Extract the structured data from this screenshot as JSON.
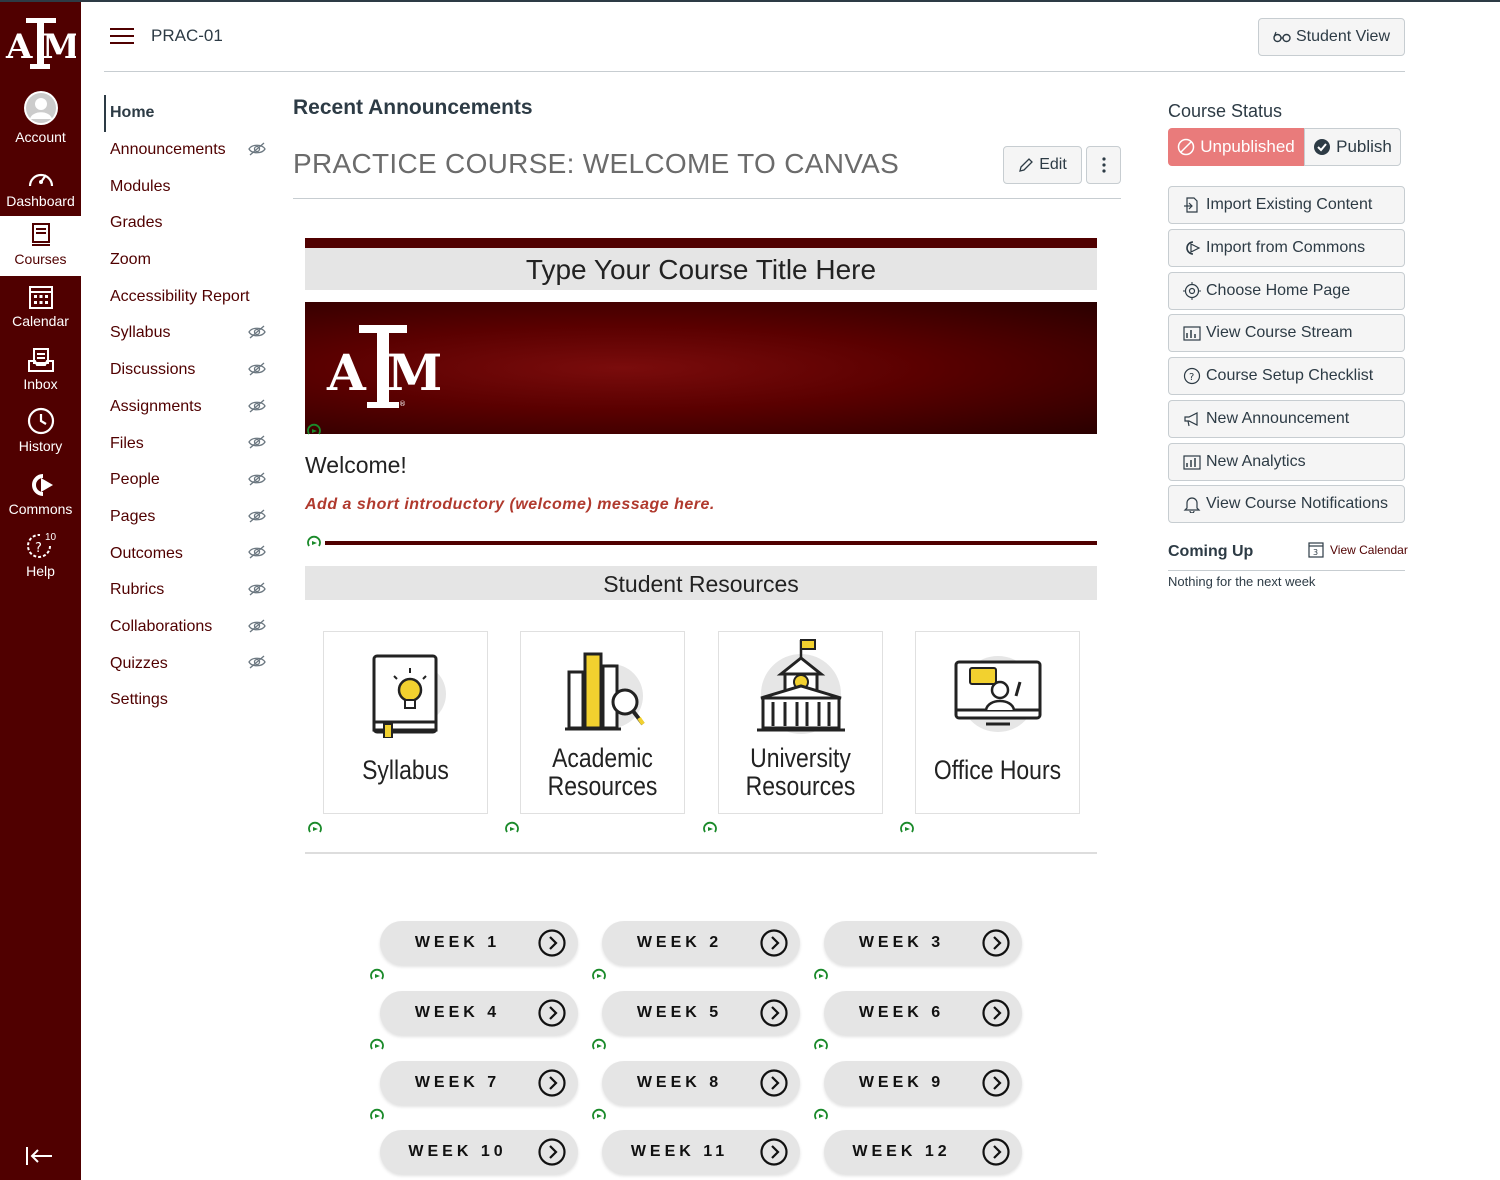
{
  "global_nav": {
    "items": [
      {
        "label": "Account",
        "icon": "account-icon"
      },
      {
        "label": "Dashboard",
        "icon": "dashboard-icon"
      },
      {
        "label": "Courses",
        "icon": "courses-icon",
        "active": true
      },
      {
        "label": "Calendar",
        "icon": "calendar-icon"
      },
      {
        "label": "Inbox",
        "icon": "inbox-icon"
      },
      {
        "label": "History",
        "icon": "history-icon"
      },
      {
        "label": "Commons",
        "icon": "commons-icon"
      },
      {
        "label": "Help",
        "icon": "help-icon",
        "badge": "10"
      }
    ],
    "brand_color": "#500000"
  },
  "header": {
    "breadcrumb": "PRAC-01",
    "student_view_label": "Student View"
  },
  "course_nav": {
    "items": [
      {
        "label": "Home",
        "active": true,
        "hidden": false
      },
      {
        "label": "Announcements",
        "hidden": true
      },
      {
        "label": "Modules",
        "hidden": false
      },
      {
        "label": "Grades",
        "hidden": false
      },
      {
        "label": "Zoom",
        "hidden": false
      },
      {
        "label": "Accessibility Report",
        "hidden": false
      },
      {
        "label": "Syllabus",
        "hidden": true
      },
      {
        "label": "Discussions",
        "hidden": true
      },
      {
        "label": "Assignments",
        "hidden": true
      },
      {
        "label": "Files",
        "hidden": true
      },
      {
        "label": "People",
        "hidden": true
      },
      {
        "label": "Pages",
        "hidden": true
      },
      {
        "label": "Outcomes",
        "hidden": true
      },
      {
        "label": "Rubrics",
        "hidden": true
      },
      {
        "label": "Collaborations",
        "hidden": true
      },
      {
        "label": "Quizzes",
        "hidden": true
      },
      {
        "label": "Settings",
        "hidden": false
      }
    ]
  },
  "main": {
    "recent_announcements": "Recent Announcements",
    "page_title": "PRACTICE COURSE: WELCOME TO CANVAS",
    "edit_label": "Edit",
    "banner_title": "Type Your Course Title Here",
    "welcome": "Welcome!",
    "intro": "Add a short introductory (welcome) message here.",
    "resources_title": "Student Resources",
    "resources": [
      {
        "line1": "Syllabus",
        "line2": "",
        "icon": "syllabus-book-icon"
      },
      {
        "line1": "Academic",
        "line2": "Resources",
        "icon": "academic-books-icon"
      },
      {
        "line1": "University",
        "line2": "Resources",
        "icon": "university-building-icon"
      },
      {
        "line1": "Office Hours",
        "line2": "",
        "icon": "office-hours-monitor-icon"
      }
    ],
    "weeks": [
      "WEEK 1",
      "WEEK 2",
      "WEEK 3",
      "WEEK 4",
      "WEEK 5",
      "WEEK 6",
      "WEEK 7",
      "WEEK 8",
      "WEEK 9",
      "WEEK 10",
      "WEEK 11",
      "WEEK 12"
    ]
  },
  "sidebar": {
    "course_status": "Course Status",
    "unpublished": "Unpublished",
    "publish": "Publish",
    "buttons": [
      {
        "label": "Import Existing Content",
        "icon": "import-icon"
      },
      {
        "label": "Import from Commons",
        "icon": "commons-icon"
      },
      {
        "label": "Choose Home Page",
        "icon": "target-icon"
      },
      {
        "label": "View Course Stream",
        "icon": "stream-chart-icon"
      },
      {
        "label": "Course Setup Checklist",
        "icon": "question-icon"
      },
      {
        "label": "New Announcement",
        "icon": "megaphone-icon"
      },
      {
        "label": "New Analytics",
        "icon": "analytics-chart-icon"
      },
      {
        "label": "View Course Notifications",
        "icon": "bell-icon"
      }
    ],
    "coming_up": "Coming Up",
    "view_calendar": "View Calendar",
    "calendar_day": "3",
    "nothing": "Nothing for the next week"
  }
}
